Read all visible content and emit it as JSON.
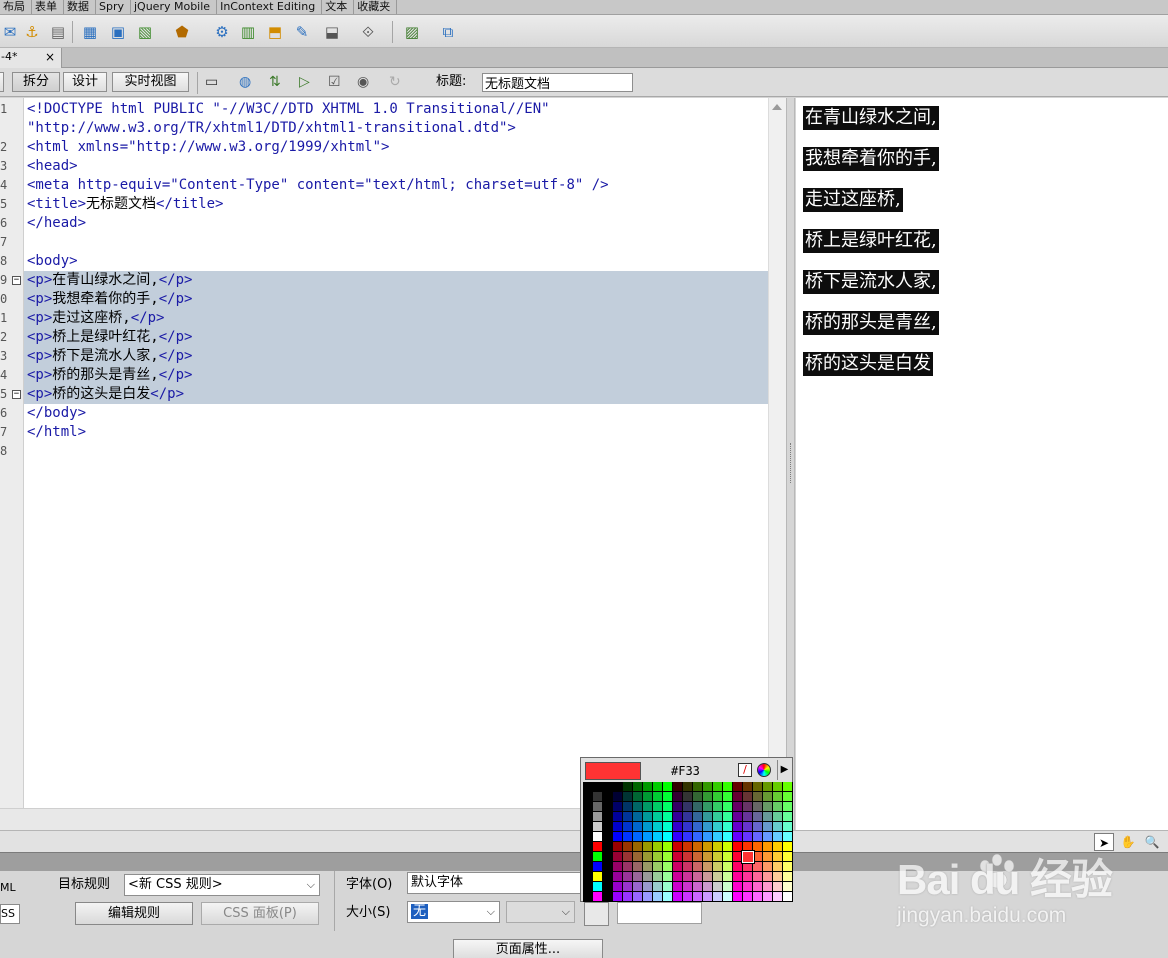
{
  "insert_categories": [
    "布局",
    "表单",
    "数据",
    "Spry",
    "jQuery Mobile",
    "InContext Editing",
    "文本",
    "收藏夹"
  ],
  "toolbar_icons": [
    {
      "name": "email-link-icon",
      "glyph": "✉"
    },
    {
      "name": "named-anchor-icon",
      "glyph": "⚓"
    },
    {
      "name": "horizontal-rule-icon",
      "glyph": "▤"
    },
    {
      "name": "table-icon",
      "glyph": "▦"
    },
    {
      "name": "div-icon",
      "glyph": "▣"
    },
    {
      "name": "image-icon",
      "glyph": "▧"
    },
    {
      "name": "media-icon",
      "glyph": "⬟"
    },
    {
      "name": "widget-icon",
      "glyph": "⚙"
    },
    {
      "name": "date-icon",
      "glyph": "▥"
    },
    {
      "name": "server-side-include-icon",
      "glyph": "⬒"
    },
    {
      "name": "comment-icon",
      "glyph": "✎"
    },
    {
      "name": "head-icon",
      "glyph": "⬓"
    },
    {
      "name": "script-icon",
      "glyph": "⟐"
    },
    {
      "name": "templates-icon",
      "glyph": "▨"
    },
    {
      "name": "tag-chooser-icon",
      "glyph": "⧉"
    }
  ],
  "document": {
    "tab_label": "-4*",
    "close_glyph": "×"
  },
  "doc_toolbar": {
    "split_label": "拆分",
    "design_label": "设计",
    "live_view_label": "实时视图",
    "title_label": "标题:",
    "title_value": "无标题文档"
  },
  "code": {
    "line_numbers": [
      "1",
      "",
      "2",
      "3",
      "4",
      "5",
      "6",
      "7",
      "8",
      "9",
      "0",
      "1",
      "2",
      "3",
      "4",
      "5",
      "6",
      "7",
      "8"
    ],
    "lines": [
      {
        "markup": "<!DOCTYPE html PUBLIC \"-//W3C//DTD XHTML 1.0 Transitional//EN\"",
        "text": ""
      },
      {
        "markup": "\"http://www.w3.org/TR/xhtml1/DTD/xhtml1-transitional.dtd\">",
        "text": ""
      },
      {
        "markup": "<html xmlns=\"http://www.w3.org/1999/xhtml\">",
        "text": ""
      },
      {
        "markup": "<head>",
        "text": ""
      },
      {
        "markup": "<meta http-equiv=\"Content-Type\" content=\"text/html; charset=utf-8\" />",
        "text": ""
      },
      {
        "markup": "<title>",
        "text": "无标题文档",
        "close": "</title>"
      },
      {
        "markup": "</head>",
        "text": ""
      },
      {
        "markup": "",
        "text": ""
      },
      {
        "markup": "<body>",
        "text": ""
      },
      {
        "markup": "<p>",
        "text": "在青山绿水之间,",
        "close": "</p>"
      },
      {
        "markup": "<p>",
        "text": "我想牵着你的手,",
        "close": "</p>"
      },
      {
        "markup": "<p>",
        "text": "走过这座桥,",
        "close": "</p>"
      },
      {
        "markup": "<p>",
        "text": "桥上是绿叶红花,",
        "close": "</p>"
      },
      {
        "markup": "<p>",
        "text": "桥下是流水人家,",
        "close": "</p>"
      },
      {
        "markup": "<p>",
        "text": "桥的那头是青丝,",
        "close": "</p>"
      },
      {
        "markup": "<p>",
        "text": "桥的这头是白发",
        "close": "</p>"
      },
      {
        "markup": "</body>",
        "text": ""
      },
      {
        "markup": "</html>",
        "text": ""
      }
    ],
    "fold_glyph": "−"
  },
  "design": {
    "paragraphs": [
      "在青山绿水之间,",
      "我想牵着你的手,",
      "走过这座桥,",
      "桥上是绿叶红花,",
      "桥下是流水人家,",
      "桥的那头是青丝,",
      "桥的这头是白发"
    ],
    "highlight_bg": "#0d0d0d",
    "highlight_fg": "#ffffff"
  },
  "status_tools": {
    "select_glyph": "➤",
    "hand_glyph": "✋",
    "zoom_glyph": "🔍"
  },
  "properties": {
    "html_tab": "ML",
    "css_tab": "SS",
    "target_rule_label": "目标规则",
    "target_rule_value": "<新 CSS 规则>",
    "edit_rule_button": "编辑规则",
    "css_panel_button": "CSS 面板(P)",
    "font_label": "字体(O)",
    "font_value": "默认字体",
    "size_label": "大小(S)",
    "size_value": "无",
    "page_properties_button": "页面属性...",
    "chevron": "⌵"
  },
  "color_picker": {
    "current_hex": "#F33",
    "current_color": "#ff3333",
    "nocolor_glyph": "/",
    "menu_glyph": "▶",
    "selected_color": "#ff3333"
  },
  "watermark": {
    "logo_text": "Bai du 经验",
    "url": "jingyan.baidu.com"
  }
}
